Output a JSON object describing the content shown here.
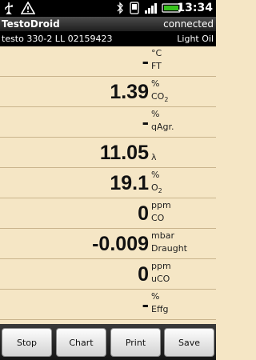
{
  "status_bar": {
    "time": "13:34",
    "icons": [
      "usb-icon",
      "warning-icon",
      "bluetooth-icon",
      "phone-icon",
      "signal-icon",
      "battery-icon"
    ],
    "battery_color": "#38c21d"
  },
  "app": {
    "title": "TestoDroid",
    "connection_status": "connected"
  },
  "device": {
    "name": "testo 330-2 LL 02159423",
    "fuel": "Light Oil"
  },
  "measurements": [
    {
      "value": "-",
      "unit": "°C",
      "label": "FT"
    },
    {
      "value": "1.39",
      "unit": "%",
      "label": "CO",
      "label_sub": "2"
    },
    {
      "value": "-",
      "unit": "%",
      "label": "qAgr."
    },
    {
      "value": "11.05",
      "unit": "",
      "label": "λ"
    },
    {
      "value": "19.1",
      "unit": "%",
      "label": "O",
      "label_sub": "2"
    },
    {
      "value": "0",
      "unit": "ppm",
      "label": "CO"
    },
    {
      "value": "-0.009",
      "unit": "mbar",
      "label": "Draught"
    },
    {
      "value": "0",
      "unit": "ppm",
      "label": "uCO"
    },
    {
      "value": "-",
      "unit": "%",
      "label": "Effg"
    }
  ],
  "buttons": {
    "stop": "Stop",
    "chart": "Chart",
    "print": "Print",
    "save": "Save"
  },
  "colors": {
    "background": "#f5e6c5",
    "row_divider": "#c9b48d"
  }
}
